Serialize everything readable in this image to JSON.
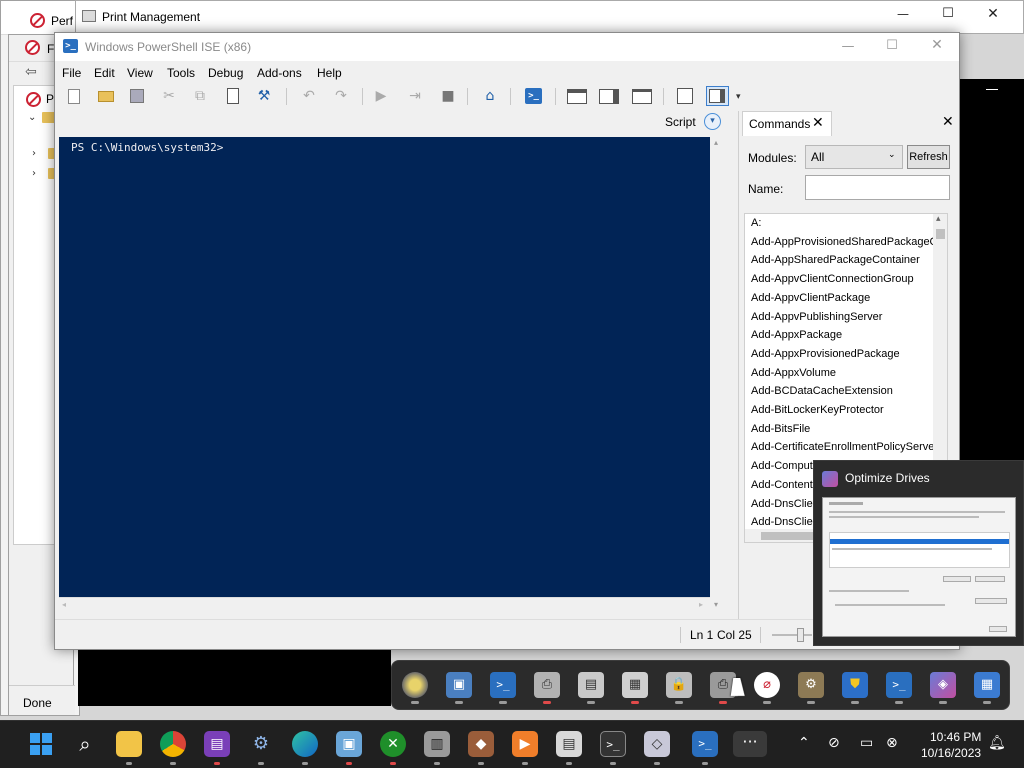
{
  "background_windows": {
    "perf_title": "Perf",
    "f_label": "F",
    "pe_label": "Pe",
    "status_done": "Done"
  },
  "print_management": {
    "title": "Print Management",
    "minimize": "—",
    "maximize": "☐",
    "close": "✕"
  },
  "ise": {
    "title": "Windows PowerShell ISE (x86)",
    "menu": [
      "File",
      "Edit",
      "View",
      "Tools",
      "Debug",
      "Add-ons",
      "Help"
    ],
    "script_label": "Script",
    "console_prompt": "PS C:\\Windows\\system32>",
    "status": {
      "line": "Ln 1",
      "col": "Col 25"
    }
  },
  "commands": {
    "tab_label": "Commands",
    "modules_label": "Modules:",
    "modules_value": "All",
    "refresh_label": "Refresh",
    "name_label": "Name:",
    "name_value": "",
    "items": [
      "A:",
      "Add-AppProvisionedSharedPackageC",
      "Add-AppSharedPackageContainer",
      "Add-AppvClientConnectionGroup",
      "Add-AppvClientPackage",
      "Add-AppvPublishingServer",
      "Add-AppxPackage",
      "Add-AppxProvisionedPackage",
      "Add-AppxVolume",
      "Add-BCDataCacheExtension",
      "Add-BitLockerKeyProtector",
      "Add-BitsFile",
      "Add-CertificateEnrollmentPolicyServe",
      "Add-Comput",
      "Add-Content",
      "Add-DnsClier",
      "Add-DnsClier",
      "Add-DtcClust"
    ]
  },
  "thumbnail": {
    "title": "Optimize Drives"
  },
  "taskbar": {
    "time": "10:46 PM",
    "date": "10/16/2023"
  },
  "colors": {
    "console_bg": "#012456",
    "console_fg": "#eeedf0",
    "taskbar_bg": "#202020",
    "accent": "#0078d4"
  }
}
